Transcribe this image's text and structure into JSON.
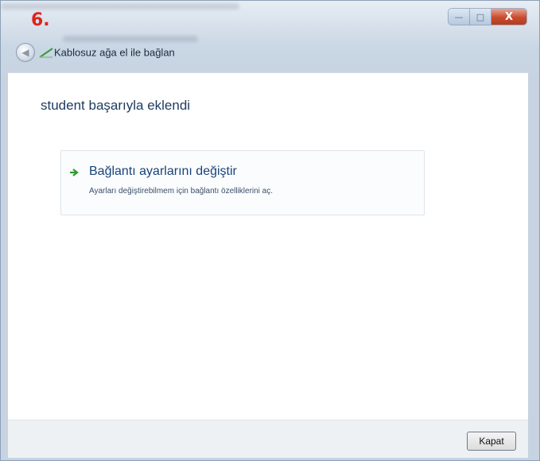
{
  "step_label": "6.",
  "window": {
    "controls": {
      "minimize": "—",
      "maximize": "□",
      "close": "X"
    },
    "colors": {
      "close_accent": "#c74c30",
      "step_label": "#e0231b"
    }
  },
  "nav": {
    "back_icon": "back-arrow-icon",
    "app_icon": "wireless-network-icon",
    "title": "Kablosuz ağa el ile bağlan"
  },
  "main": {
    "headline": "student başarıyla eklendi",
    "link": {
      "icon": "green-arrow-icon",
      "title": "Bağlantı ayarlarını değiştir",
      "description": "Ayarları değiştirebilmem için bağlantı özelliklerini aç."
    }
  },
  "footer": {
    "close_button_label": "Kapat"
  }
}
